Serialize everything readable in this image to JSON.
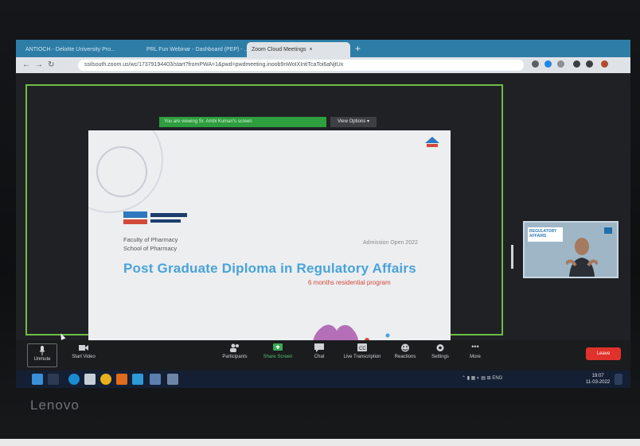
{
  "browser": {
    "tabs": [
      {
        "label": "ANTIOCH - Deloitte University Pro...",
        "active": false
      },
      {
        "label": "PRL Fun Webinar - Dashboard (PEP) - ...",
        "active": false
      },
      {
        "label": "Zoom Cloud Meetings",
        "active": true
      }
    ],
    "url": "ssilsouth.zoom.us/wc/17379194403/start?fromPWA=1&pwd=pwdmeeting.inoob9nWoIXIntiTcaToi6aNjtUx"
  },
  "zoom": {
    "sharing_banner": "You are viewing Sr. Ambi Kumari's screen",
    "view_options": "View Options",
    "participant_label": "REGULATORY AFFAIRS",
    "controls": {
      "mute": "Unmute",
      "start_video": "Start Video",
      "participants": "Participants",
      "share_screen": "Share Screen",
      "chat": "Chat",
      "live_transcript": "Live Transcription",
      "reactions": "Reactions",
      "settings": "Settings",
      "more": "More",
      "end": "Leave"
    }
  },
  "slide": {
    "logo_text": "BENNETT UNIVERSITY",
    "faculty": "Faculty of Pharmacy",
    "school": "School of Pharmacy",
    "admission": "Admission Open 2022",
    "title": "Post Graduate Diploma in Regulatory Affairs",
    "subtitle": "6 months residential program"
  },
  "laptop": {
    "brand": "Lenovo"
  },
  "taskbar": {
    "clock_time": "19:07",
    "clock_date": "11-03-2022"
  },
  "colors": {
    "accent_green": "#6dbd46",
    "end_red": "#e0322b",
    "title_blue": "#4aa3d8"
  }
}
